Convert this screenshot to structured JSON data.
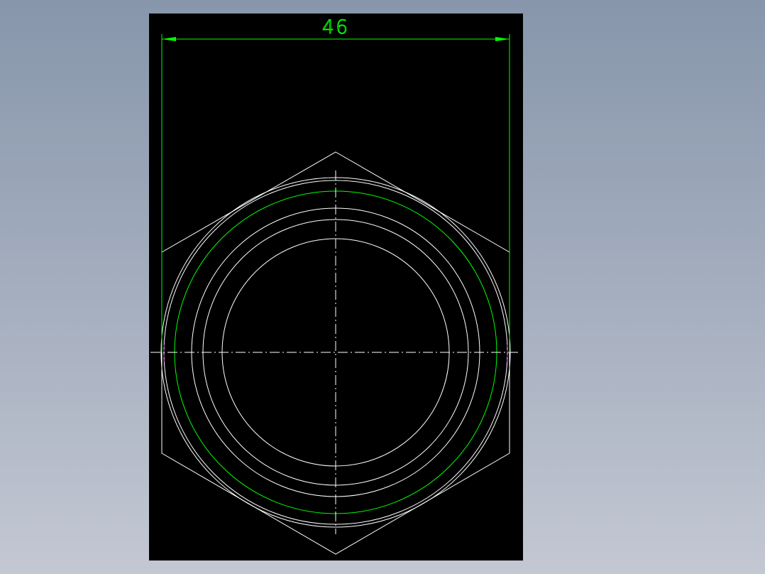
{
  "drawing": {
    "view": "hex-nut-top-view",
    "dimension": {
      "value": "46"
    },
    "colors": {
      "background": "#000000",
      "geometry": "#ffffff",
      "dimension": "#00ff00",
      "thread_circle": "#00ff00",
      "marker": "#ff00ff",
      "page": "#8f9cb0"
    },
    "elements": [
      "hexagon-outline",
      "chamfer-circle",
      "thread-major-circle",
      "face-circle-1",
      "face-circle-2",
      "bore-circle",
      "horizontal-centerline",
      "vertical-centerline",
      "dimension-line-46"
    ]
  }
}
